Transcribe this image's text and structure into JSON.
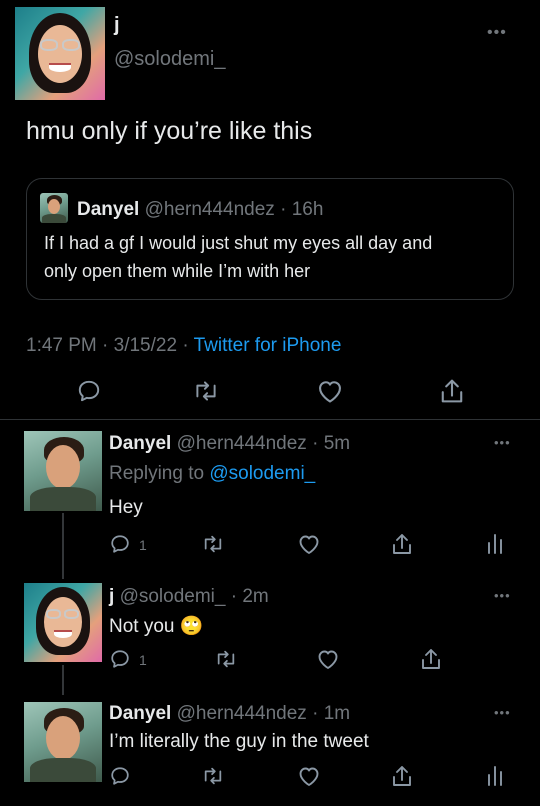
{
  "main_tweet": {
    "name": "j",
    "handle": "@solodemi_",
    "text": "hmu only if you’re like this",
    "quoted": {
      "name": "Danyel",
      "handle_time": "@hern444ndez · 16h",
      "text_line1": "If I had a gf I would just shut my eyes all day and",
      "text_line2": "only open them while I’m with her"
    },
    "time_date": "1:47 PM · 3/15/22 · ",
    "client": "Twitter for iPhone"
  },
  "replies": [
    {
      "name": "Danyel",
      "handle_time": "@hern444ndez · 5m",
      "replying_prefix": "Replying to ",
      "replying_handle": "@solodemi_",
      "text": "Hey",
      "reply_count": "1"
    },
    {
      "name": "j",
      "handle_time": "@solodemi_ · 2m",
      "text": "Not you",
      "emoji": "🙄",
      "reply_count": "1"
    },
    {
      "name": "Danyel",
      "handle_time": "@hern444ndez · 1m",
      "text": "I’m literally the guy in the tweet"
    }
  ],
  "icons": {
    "reply": "reply-icon",
    "retweet": "retweet-icon",
    "like": "heart-icon",
    "share": "share-icon",
    "analytics": "analytics-icon",
    "more": "more-icon"
  },
  "colors": {
    "background": "#000000",
    "text": "#e7e9ea",
    "muted": "#71767b",
    "link": "#1d9bf0",
    "border": "#2f3336"
  }
}
